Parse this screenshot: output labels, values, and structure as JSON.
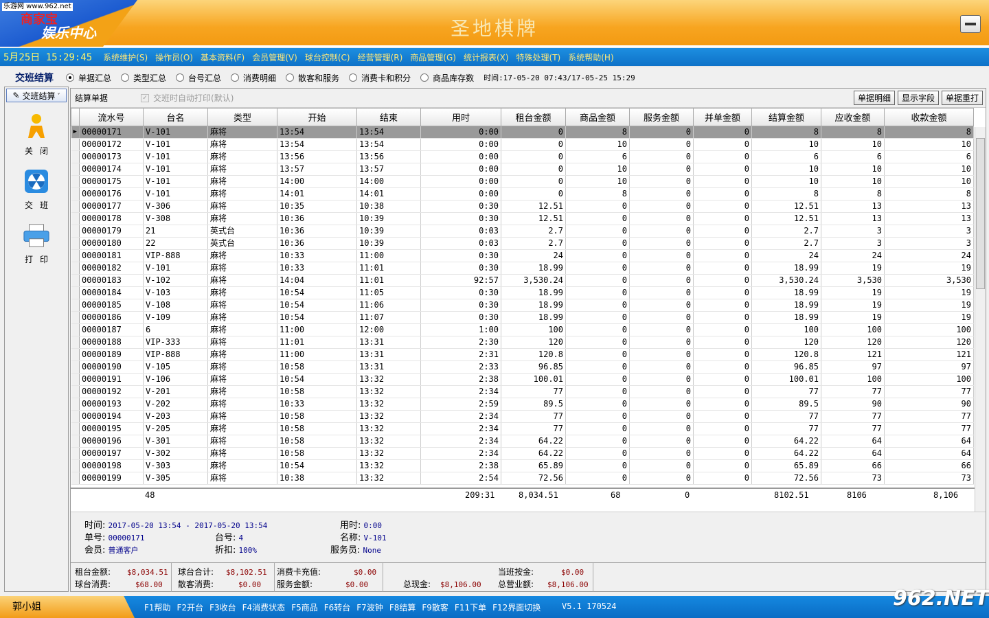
{
  "titlebar": {
    "watermark_top": "乐游网 www.962.net",
    "logo_name": "商家宝",
    "logo_sub": "娱乐中心",
    "app_title": "圣地棋牌"
  },
  "menubar": {
    "clock": "5月25日 15:29:45",
    "items": [
      "系统维护(S)",
      "操作员(O)",
      "基本资料(F)",
      "会员管理(V)",
      "球台控制(C)",
      "经营管理(R)",
      "商品管理(G)",
      "统计报表(X)",
      "特殊处理(T)",
      "系统帮助(H)"
    ]
  },
  "options": {
    "title": "交班结算",
    "radios": [
      "单据汇总",
      "类型汇总",
      "台号汇总",
      "消费明细",
      "散客和服务",
      "消费卡和积分",
      "商品库存数"
    ],
    "selected": 0,
    "time_range": "时间:17-05-20 07:43/17-05-25 15:29"
  },
  "sidebar": {
    "top_label": "交班结算",
    "buttons": [
      {
        "label": "关闭",
        "icon": "person-running-icon"
      },
      {
        "label": "交班",
        "icon": "radiation-icon"
      },
      {
        "label": "打印",
        "icon": "printer-icon"
      }
    ]
  },
  "main": {
    "label": "结算单据",
    "auto_print": "交班时自动打印(默认)",
    "buttons": [
      "单据明细",
      "显示字段",
      "单据重打"
    ]
  },
  "grid": {
    "columns": [
      "流水号",
      "台名",
      "类型",
      "开始",
      "结束",
      "用时",
      "租台金额",
      "商品金额",
      "服务金额",
      "并单金额",
      "结算金额",
      "应收金额",
      "收款金额"
    ],
    "rows": [
      [
        "00000171",
        "V-101",
        "麻将",
        "13:54",
        "13:54",
        "0:00",
        "0",
        "8",
        "0",
        "0",
        "8",
        "8",
        "8"
      ],
      [
        "00000172",
        "V-101",
        "麻将",
        "13:54",
        "13:54",
        "0:00",
        "0",
        "10",
        "0",
        "0",
        "10",
        "10",
        "10"
      ],
      [
        "00000173",
        "V-101",
        "麻将",
        "13:56",
        "13:56",
        "0:00",
        "0",
        "6",
        "0",
        "0",
        "6",
        "6",
        "6"
      ],
      [
        "00000174",
        "V-101",
        "麻将",
        "13:57",
        "13:57",
        "0:00",
        "0",
        "10",
        "0",
        "0",
        "10",
        "10",
        "10"
      ],
      [
        "00000175",
        "V-101",
        "麻将",
        "14:00",
        "14:00",
        "0:00",
        "0",
        "10",
        "0",
        "0",
        "10",
        "10",
        "10"
      ],
      [
        "00000176",
        "V-101",
        "麻将",
        "14:01",
        "14:01",
        "0:00",
        "0",
        "8",
        "0",
        "0",
        "8",
        "8",
        "8"
      ],
      [
        "00000177",
        "V-306",
        "麻将",
        "10:35",
        "10:38",
        "0:30",
        "12.51",
        "0",
        "0",
        "0",
        "12.51",
        "13",
        "13"
      ],
      [
        "00000178",
        "V-308",
        "麻将",
        "10:36",
        "10:39",
        "0:30",
        "12.51",
        "0",
        "0",
        "0",
        "12.51",
        "13",
        "13"
      ],
      [
        "00000179",
        "21",
        "英式台",
        "10:36",
        "10:39",
        "0:03",
        "2.7",
        "0",
        "0",
        "0",
        "2.7",
        "3",
        "3"
      ],
      [
        "00000180",
        "22",
        "英式台",
        "10:36",
        "10:39",
        "0:03",
        "2.7",
        "0",
        "0",
        "0",
        "2.7",
        "3",
        "3"
      ],
      [
        "00000181",
        "VIP-888",
        "麻将",
        "10:33",
        "11:00",
        "0:30",
        "24",
        "0",
        "0",
        "0",
        "24",
        "24",
        "24"
      ],
      [
        "00000182",
        "V-101",
        "麻将",
        "10:33",
        "11:01",
        "0:30",
        "18.99",
        "0",
        "0",
        "0",
        "18.99",
        "19",
        "19"
      ],
      [
        "00000183",
        "V-102",
        "麻将",
        "14:04",
        "11:01",
        "92:57",
        "3,530.24",
        "0",
        "0",
        "0",
        "3,530.24",
        "3,530",
        "3,530"
      ],
      [
        "00000184",
        "V-103",
        "麻将",
        "10:54",
        "11:05",
        "0:30",
        "18.99",
        "0",
        "0",
        "0",
        "18.99",
        "19",
        "19"
      ],
      [
        "00000185",
        "V-108",
        "麻将",
        "10:54",
        "11:06",
        "0:30",
        "18.99",
        "0",
        "0",
        "0",
        "18.99",
        "19",
        "19"
      ],
      [
        "00000186",
        "V-109",
        "麻将",
        "10:54",
        "11:07",
        "0:30",
        "18.99",
        "0",
        "0",
        "0",
        "18.99",
        "19",
        "19"
      ],
      [
        "00000187",
        "6",
        "麻将",
        "11:00",
        "12:00",
        "1:00",
        "100",
        "0",
        "0",
        "0",
        "100",
        "100",
        "100"
      ],
      [
        "00000188",
        "VIP-333",
        "麻将",
        "11:01",
        "13:31",
        "2:30",
        "120",
        "0",
        "0",
        "0",
        "120",
        "120",
        "120"
      ],
      [
        "00000189",
        "VIP-888",
        "麻将",
        "11:00",
        "13:31",
        "2:31",
        "120.8",
        "0",
        "0",
        "0",
        "120.8",
        "121",
        "121"
      ],
      [
        "00000190",
        "V-105",
        "麻将",
        "10:58",
        "13:31",
        "2:33",
        "96.85",
        "0",
        "0",
        "0",
        "96.85",
        "97",
        "97"
      ],
      [
        "00000191",
        "V-106",
        "麻将",
        "10:54",
        "13:32",
        "2:38",
        "100.01",
        "0",
        "0",
        "0",
        "100.01",
        "100",
        "100"
      ],
      [
        "00000192",
        "V-201",
        "麻将",
        "10:58",
        "13:32",
        "2:34",
        "77",
        "0",
        "0",
        "0",
        "77",
        "77",
        "77"
      ],
      [
        "00000193",
        "V-202",
        "麻将",
        "10:33",
        "13:32",
        "2:59",
        "89.5",
        "0",
        "0",
        "0",
        "89.5",
        "90",
        "90"
      ],
      [
        "00000194",
        "V-203",
        "麻将",
        "10:58",
        "13:32",
        "2:34",
        "77",
        "0",
        "0",
        "0",
        "77",
        "77",
        "77"
      ],
      [
        "00000195",
        "V-205",
        "麻将",
        "10:58",
        "13:32",
        "2:34",
        "77",
        "0",
        "0",
        "0",
        "77",
        "77",
        "77"
      ],
      [
        "00000196",
        "V-301",
        "麻将",
        "10:58",
        "13:32",
        "2:34",
        "64.22",
        "0",
        "0",
        "0",
        "64.22",
        "64",
        "64"
      ],
      [
        "00000197",
        "V-302",
        "麻将",
        "10:58",
        "13:32",
        "2:34",
        "64.22",
        "0",
        "0",
        "0",
        "64.22",
        "64",
        "64"
      ],
      [
        "00000198",
        "V-303",
        "麻将",
        "10:54",
        "13:32",
        "2:38",
        "65.89",
        "0",
        "0",
        "0",
        "65.89",
        "66",
        "66"
      ],
      [
        "00000199",
        "V-305",
        "麻将",
        "10:38",
        "13:32",
        "2:54",
        "72.56",
        "0",
        "0",
        "0",
        "72.56",
        "73",
        "73"
      ]
    ],
    "summary": {
      "count": "48",
      "duration": "209:31",
      "rent": "8,034.51",
      "goods": "68",
      "service": "0",
      "settle": "8102.51",
      "due": "8106",
      "received": "8,106"
    }
  },
  "detail": {
    "time_label": "时间:",
    "time_value": "2017-05-20 13:54 - 2017-05-20 13:54",
    "duration_label": "用时:",
    "duration_value": "0:00",
    "no_label": "单号:",
    "no_value": "00000171",
    "table_label": "台号:",
    "table_value": "4",
    "name_label": "名称:",
    "name_value": "V-101",
    "member_label": "会员:",
    "member_value": "普通客户",
    "discount_label": "折扣:",
    "discount_value": "100%",
    "waiter_label": "服务员:",
    "waiter_value": "None"
  },
  "totals": {
    "rent_label": "租台金额:",
    "rent_value": "$8,034.51",
    "table_sum_label": "球台合计:",
    "table_sum_value": "$8,102.51",
    "card_label": "消费卡充值:",
    "card_value": "$0.00",
    "shift_label": "当班按金:",
    "shift_value": "$0.00",
    "table_cons_label": "球台消费:",
    "table_cons_value": "$68.00",
    "walkin_label": "散客消费:",
    "walkin_value": "$0.00",
    "service_label": "服务金额:",
    "service_value": "$0.00",
    "cash_label": "总现金:",
    "cash_value": "$8,106.00",
    "revenue_label": "总营业额:",
    "revenue_value": "$8,106.00"
  },
  "statusbar": {
    "user": "郭小姐",
    "fkeys": [
      "F1帮助",
      "F2开台",
      "F3收台",
      "F4消费状态",
      "F5商品",
      "F6转台",
      "F7波钟",
      "F8结算",
      "F9散客",
      "F11下单",
      "F12界面切换"
    ],
    "version": "V5.1 170524",
    "watermark": "962.NET"
  }
}
